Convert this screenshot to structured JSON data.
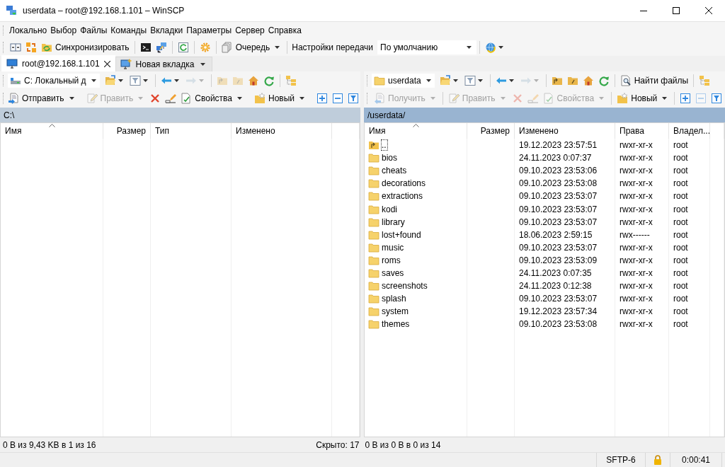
{
  "window": {
    "title": "userdata – root@192.168.1.101 – WinSCP"
  },
  "menu": [
    "Локально",
    "Выбор",
    "Файлы",
    "Команды",
    "Вкладки",
    "Параметры",
    "Сервер",
    "Справка"
  ],
  "toolbar": [
    {
      "kind": "icon",
      "disabled": false
    },
    {
      "kind": "icon",
      "disabled": false
    },
    {
      "kind": "button",
      "label": "Синхронизировать",
      "disabled": false
    },
    {
      "kind": "sep"
    },
    {
      "kind": "icon",
      "disabled": false
    },
    {
      "kind": "icon",
      "disabled": false
    },
    {
      "kind": "sep"
    },
    {
      "kind": "icon",
      "disabled": false
    },
    {
      "kind": "sep"
    },
    {
      "kind": "icon",
      "disabled": false
    },
    {
      "kind": "sep"
    },
    {
      "kind": "button",
      "label": "Очередь",
      "dropdown": true,
      "disabled": false
    },
    {
      "kind": "sep"
    },
    {
      "kind": "label",
      "label": "Настройки передачи"
    },
    {
      "kind": "select",
      "value": "По умолчанию"
    },
    {
      "kind": "sep"
    },
    {
      "kind": "icon",
      "dropdown": true,
      "disabled": false
    }
  ],
  "tabs": [
    {
      "kind": "session",
      "label": "root@192.168.1.101",
      "selected": true
    },
    {
      "kind": "new",
      "label": "Новая вкладка",
      "selected": false
    }
  ],
  "panels": [
    {
      "active": false,
      "nav_toolbar": [
        {
          "kind": "combo",
          "value": "C: Локальный д"
        },
        {
          "kind": "icon",
          "dropdown": true,
          "disabled": false
        },
        {
          "kind": "icon",
          "dropdown": true,
          "disabled": false
        },
        {
          "kind": "sep"
        },
        {
          "kind": "icon",
          "dropdown": true,
          "disabled": false
        },
        {
          "kind": "icon",
          "dropdown": true,
          "disabled": true
        },
        {
          "kind": "sep"
        },
        {
          "kind": "icon",
          "disabled": true
        },
        {
          "kind": "icon",
          "disabled": true
        },
        {
          "kind": "icon",
          "disabled": false
        },
        {
          "kind": "icon",
          "disabled": false
        },
        {
          "kind": "sep"
        },
        {
          "kind": "icon",
          "disabled": false
        }
      ],
      "file_toolbar": [
        {
          "kind": "button",
          "label": "Отправить",
          "dropdown": true,
          "disabled": false
        },
        {
          "kind": "sep"
        },
        {
          "kind": "button",
          "label": "Править",
          "dropdown": true,
          "disabled": true
        },
        {
          "kind": "icon",
          "disabled": false
        },
        {
          "kind": "icon",
          "disabled": false
        },
        {
          "kind": "button",
          "label": "Свойства",
          "dropdown": true,
          "disabled": false
        },
        {
          "kind": "sep"
        },
        {
          "kind": "button",
          "label": "Новый",
          "dropdown": true,
          "disabled": false
        },
        {
          "kind": "sep"
        },
        {
          "kind": "icon",
          "disabled": false
        },
        {
          "kind": "icon",
          "disabled": false
        },
        {
          "kind": "icon",
          "disabled": false
        }
      ],
      "path": "C:\\",
      "columns": [
        {
          "kind": "name",
          "label": "Имя",
          "sorted": true
        },
        {
          "kind": "size",
          "label": "Размер",
          "sorted": false
        },
        {
          "kind": "type",
          "label": "Тип",
          "sorted": false
        },
        {
          "kind": "date",
          "label": "Изменено",
          "sorted": false
        }
      ],
      "status": "0 B из 9,43 KB в 1 из 16",
      "hidden": "Скрыто: 17"
    },
    {
      "active": true,
      "nav_toolbar": [
        {
          "kind": "combo",
          "value": "userdata"
        },
        {
          "kind": "icon",
          "dropdown": true,
          "disabled": false
        },
        {
          "kind": "icon",
          "dropdown": true,
          "disabled": false
        },
        {
          "kind": "sep"
        },
        {
          "kind": "icon",
          "dropdown": true,
          "disabled": false
        },
        {
          "kind": "icon",
          "dropdown": true,
          "disabled": true
        },
        {
          "kind": "sep"
        },
        {
          "kind": "icon",
          "disabled": false
        },
        {
          "kind": "icon",
          "disabled": false
        },
        {
          "kind": "icon",
          "disabled": false
        },
        {
          "kind": "icon",
          "disabled": false
        },
        {
          "kind": "sep"
        },
        {
          "kind": "button",
          "label": "Найти файлы",
          "disabled": false
        },
        {
          "kind": "sep"
        },
        {
          "kind": "icon",
          "disabled": false
        }
      ],
      "file_toolbar": [
        {
          "kind": "button",
          "label": "Получить",
          "dropdown": true,
          "disabled": true
        },
        {
          "kind": "sep"
        },
        {
          "kind": "button",
          "label": "Править",
          "dropdown": true,
          "disabled": true
        },
        {
          "kind": "icon",
          "disabled": true
        },
        {
          "kind": "icon",
          "disabled": true
        },
        {
          "kind": "button",
          "label": "Свойства",
          "dropdown": true,
          "disabled": true
        },
        {
          "kind": "sep"
        },
        {
          "kind": "button",
          "label": "Новый",
          "dropdown": true,
          "disabled": false
        },
        {
          "kind": "sep"
        },
        {
          "kind": "icon",
          "disabled": false
        },
        {
          "kind": "icon",
          "disabled": true
        },
        {
          "kind": "icon",
          "disabled": false
        }
      ],
      "path": "/userdata/",
      "columns": [
        {
          "kind": "name",
          "label": "Имя",
          "sorted": true
        },
        {
          "kind": "size",
          "label": "Размер",
          "sorted": false
        },
        {
          "kind": "date",
          "label": "Изменено",
          "sorted": false
        },
        {
          "kind": "rights",
          "label": "Права",
          "sorted": false
        },
        {
          "kind": "owner",
          "label": "Владел...",
          "sorted": false
        }
      ],
      "rows": [
        {
          "kind": "parent",
          "name": "..",
          "modified": "19.12.2023 23:57:51",
          "rights": "rwxr-xr-x",
          "owner": "root",
          "focused": true
        },
        {
          "kind": "folder",
          "name": "bios",
          "modified": "24.11.2023 0:07:37",
          "rights": "rwxr-xr-x",
          "owner": "root",
          "focused": false
        },
        {
          "kind": "folder",
          "name": "cheats",
          "modified": "09.10.2023 23:53:06",
          "rights": "rwxr-xr-x",
          "owner": "root",
          "focused": false
        },
        {
          "kind": "folder",
          "name": "decorations",
          "modified": "09.10.2023 23:53:08",
          "rights": "rwxr-xr-x",
          "owner": "root",
          "focused": false
        },
        {
          "kind": "folder",
          "name": "extractions",
          "modified": "09.10.2023 23:53:07",
          "rights": "rwxr-xr-x",
          "owner": "root",
          "focused": false
        },
        {
          "kind": "folder",
          "name": "kodi",
          "modified": "09.10.2023 23:53:07",
          "rights": "rwxr-xr-x",
          "owner": "root",
          "focused": false
        },
        {
          "kind": "folder",
          "name": "library",
          "modified": "09.10.2023 23:53:07",
          "rights": "rwxr-xr-x",
          "owner": "root",
          "focused": false
        },
        {
          "kind": "folder",
          "name": "lost+found",
          "modified": "18.06.2023 2:59:15",
          "rights": "rwx------",
          "owner": "root",
          "focused": false
        },
        {
          "kind": "folder",
          "name": "music",
          "modified": "09.10.2023 23:53:07",
          "rights": "rwxr-xr-x",
          "owner": "root",
          "focused": false
        },
        {
          "kind": "folder",
          "name": "roms",
          "modified": "09.10.2023 23:53:09",
          "rights": "rwxr-xr-x",
          "owner": "root",
          "focused": false
        },
        {
          "kind": "folder",
          "name": "saves",
          "modified": "24.11.2023 0:07:35",
          "rights": "rwxr-xr-x",
          "owner": "root",
          "focused": false
        },
        {
          "kind": "folder",
          "name": "screenshots",
          "modified": "24.11.2023 0:12:38",
          "rights": "rwxr-xr-x",
          "owner": "root",
          "focused": false
        },
        {
          "kind": "folder",
          "name": "splash",
          "modified": "09.10.2023 23:53:07",
          "rights": "rwxr-xr-x",
          "owner": "root",
          "focused": false
        },
        {
          "kind": "folder",
          "name": "system",
          "modified": "19.12.2023 23:57:34",
          "rights": "rwxr-xr-x",
          "owner": "root",
          "focused": false
        },
        {
          "kind": "folder",
          "name": "themes",
          "modified": "09.10.2023 23:53:08",
          "rights": "rwxr-xr-x",
          "owner": "root",
          "focused": false
        }
      ],
      "status": "0 B из 0 B в 0 из 14"
    }
  ],
  "status_bar": {
    "protocol": "SFTP-6",
    "time": "0:00:41"
  }
}
